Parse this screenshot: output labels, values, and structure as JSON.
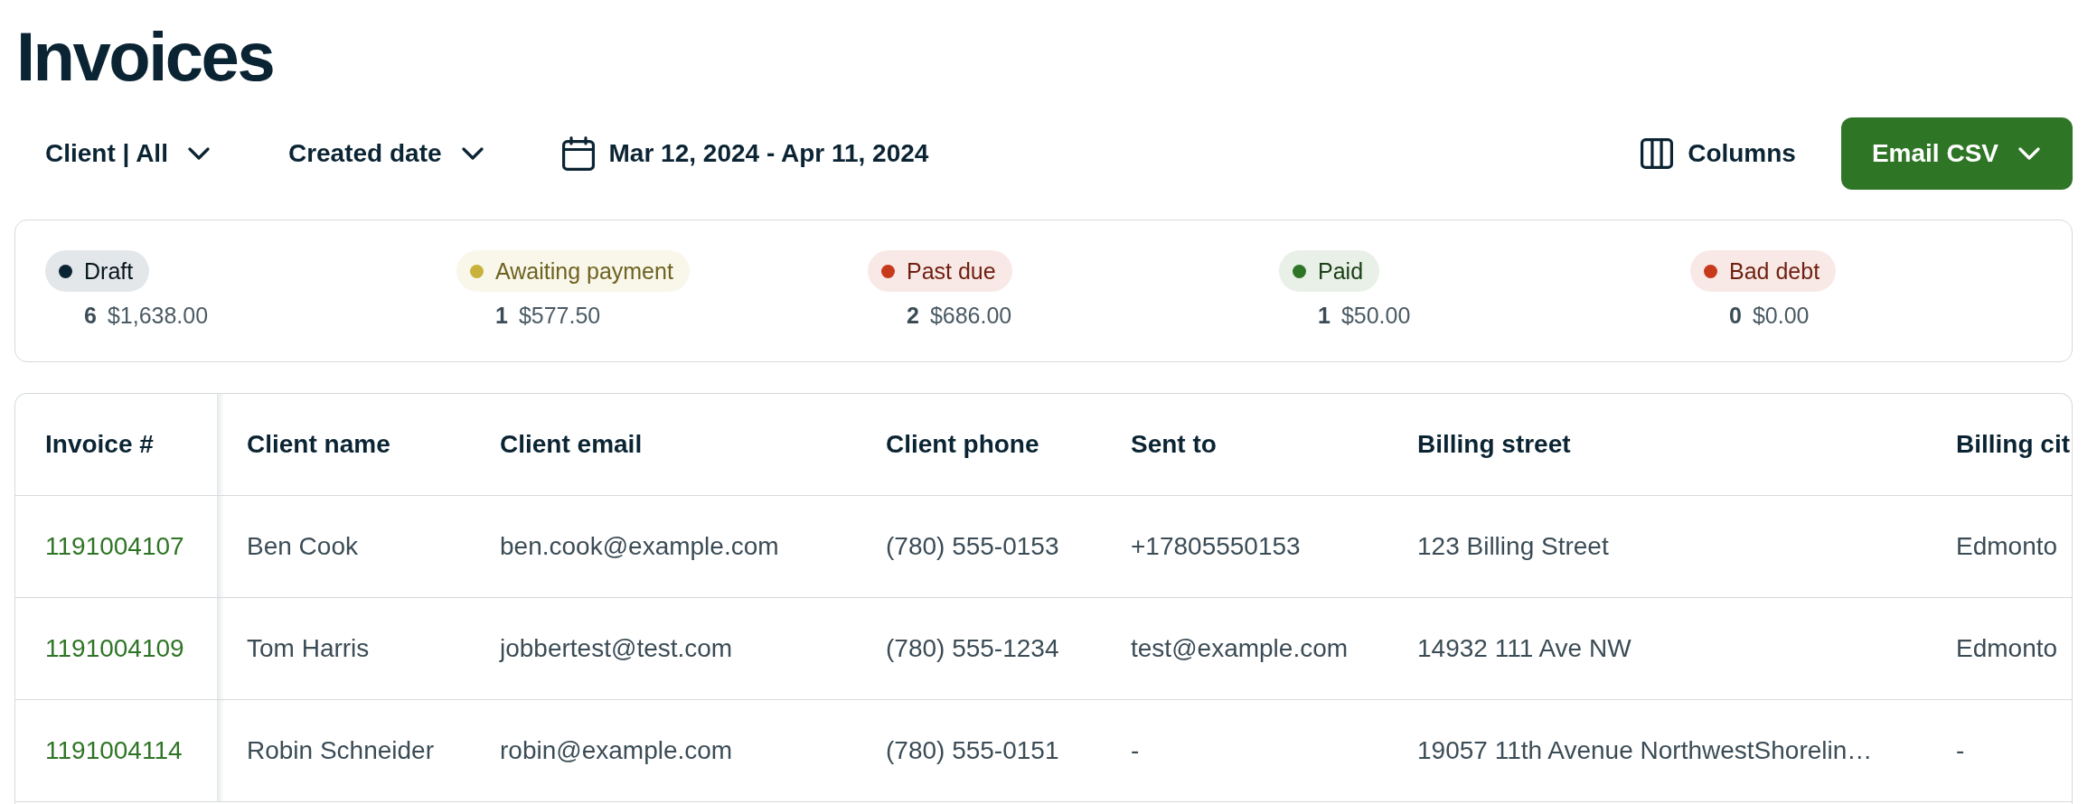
{
  "title": "Invoices",
  "filters": [
    {
      "kind": "dropdown",
      "label": "Client | All"
    },
    {
      "kind": "dropdown",
      "label": "Created date"
    },
    {
      "kind": "date_range",
      "label": "Mar 12, 2024 - Apr 11, 2024"
    }
  ],
  "actions": [
    {
      "kind": "columns",
      "label": "Columns"
    },
    {
      "kind": "export_menu",
      "label": "Email CSV"
    }
  ],
  "summary": [
    {
      "label": "Draft",
      "color": "#0b2433",
      "count": "6",
      "amount": "$1,638.00"
    },
    {
      "label": "Awaiting payment",
      "color": "#c8b23c",
      "count": "1",
      "amount": "$577.50"
    },
    {
      "label": "Past due",
      "color": "#c8391c",
      "count": "2",
      "amount": "$686.00"
    },
    {
      "label": "Paid",
      "color": "#2f7526",
      "count": "1",
      "amount": "$50.00"
    },
    {
      "label": "Bad debt",
      "color": "#c8391c",
      "count": "0",
      "amount": "$0.00"
    }
  ],
  "table": {
    "columns": [
      {
        "label": "Invoice #",
        "kind": "link"
      },
      {
        "label": "Client name",
        "kind": "text"
      },
      {
        "label": "Client email",
        "kind": "text"
      },
      {
        "label": "Client phone",
        "kind": "text"
      },
      {
        "label": "Sent to",
        "kind": "text"
      },
      {
        "label": "Billing street",
        "kind": "text"
      },
      {
        "label": "Billing cit",
        "kind": "text"
      }
    ],
    "rows": [
      {
        "cells": [
          "1191004107",
          "Ben Cook",
          "ben.cook@example.com",
          "(780) 555-0153",
          "+17805550153",
          "123 Billing Street",
          "Edmonto"
        ]
      },
      {
        "cells": [
          "1191004109",
          "Tom Harris",
          "jobbertest@test.com",
          "(780) 555-1234",
          "test@example.com",
          "14932 111 Ave NW",
          "Edmonto"
        ]
      },
      {
        "cells": [
          "1191004114",
          "Robin Schneider",
          "robin@example.com",
          "(780) 555-0151",
          "-",
          "19057 11th Avenue NorthwestShorelin…",
          "-"
        ]
      }
    ]
  }
}
